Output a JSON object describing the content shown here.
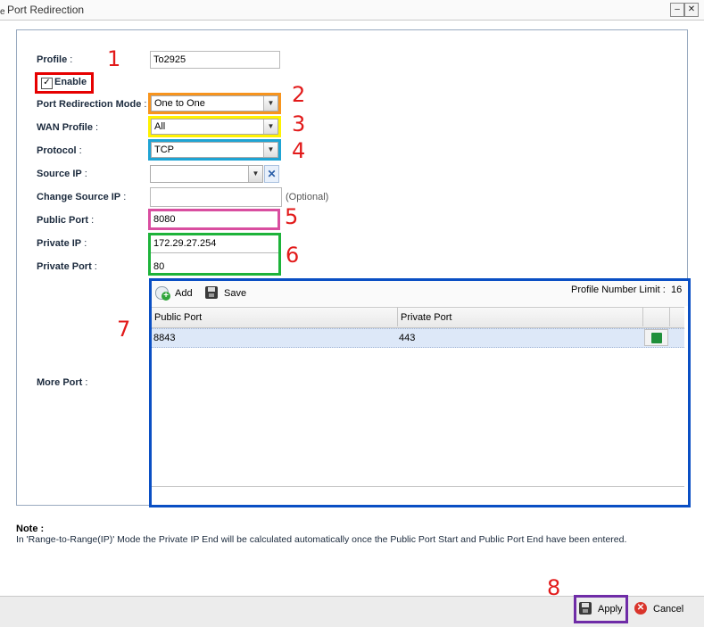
{
  "window": {
    "title": "Port Redirection",
    "left_stub": "e",
    "minimize_label": "–",
    "close_label": "✕"
  },
  "annotations": {
    "n1": "1",
    "n2": "2",
    "n3": "3",
    "n4": "4",
    "n5": "5",
    "n6": "6",
    "n7": "7",
    "n8": "8"
  },
  "form": {
    "profile": {
      "label": "Profile",
      "value": "To2925"
    },
    "enable": {
      "label": "Enable",
      "checked": true
    },
    "mode": {
      "label": "Port Redirection Mode",
      "value": "One to One"
    },
    "wan_profile": {
      "label": "WAN Profile",
      "value": "All"
    },
    "protocol": {
      "label": "Protocol",
      "value": "TCP"
    },
    "source_ip": {
      "label": "Source IP",
      "value": ""
    },
    "change_source_ip": {
      "label": "Change Source IP",
      "value": "",
      "hint": "(Optional)"
    },
    "public_port": {
      "label": "Public Port",
      "value": "8080"
    },
    "private_ip": {
      "label": "Private IP",
      "value": "172.29.27.254"
    },
    "private_port": {
      "label": "Private Port",
      "value": "80"
    },
    "more_port": {
      "label": "More Port"
    }
  },
  "grid": {
    "add_label": "Add",
    "save_label": "Save",
    "limit_label": "Profile Number Limit :",
    "limit_value": "16",
    "columns": [
      "Public Port",
      "Private Port"
    ],
    "rows": [
      {
        "public_port": "8843",
        "private_port": "443"
      }
    ]
  },
  "note": {
    "title": "Note :",
    "text": "In 'Range-to-Range(IP)' Mode the Private IP End will be calculated automatically once the Public Port Start and Public Port End have been entered."
  },
  "footer": {
    "apply_label": "Apply",
    "cancel_label": "Cancel"
  },
  "colors": {
    "red": "#e60000",
    "orange": "#f7941d",
    "yellow": "#fff200",
    "cyan": "#1ea4d4",
    "pink": "#d94ea0",
    "green": "#1db33a",
    "blue": "#0a4fc4",
    "purple": "#6f2ca7"
  }
}
